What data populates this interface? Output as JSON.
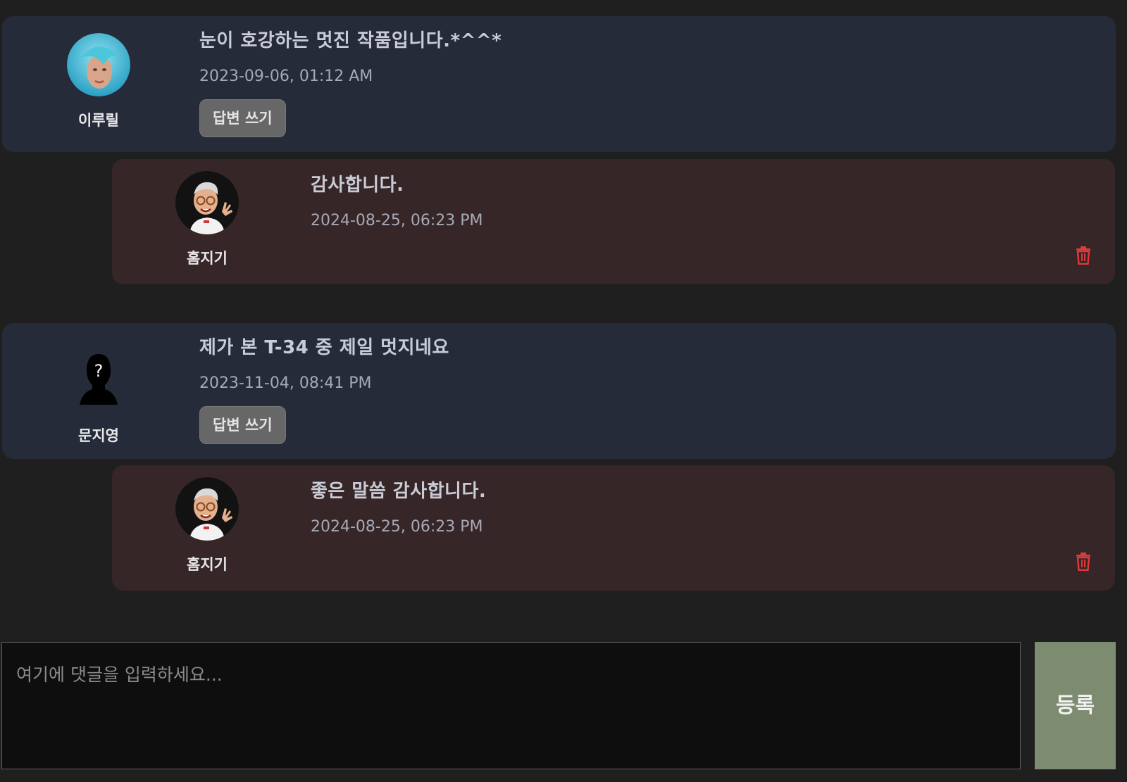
{
  "comments": [
    {
      "author": "이루릴",
      "avatar_icon": "blue-hair-avatar-icon",
      "text": "눈이 호강하는 멋진 작품입니다.*^^*",
      "date": "2023-09-06, 01:12 AM",
      "reply_button_label": "답변 쓰기",
      "reply": {
        "author": "홈지기",
        "avatar_icon": "memoji-avatar-icon",
        "text": "감사합니다.",
        "date": "2024-08-25, 06:23 PM",
        "delete_icon": "trash-icon"
      }
    },
    {
      "author": "문지영",
      "avatar_icon": "unknown-user-silhouette-icon",
      "text": "제가 본 T-34 중 제일 멋지네요",
      "date": "2023-11-04, 08:41 PM",
      "reply_button_label": "답변 쓰기",
      "reply": {
        "author": "홈지기",
        "avatar_icon": "memoji-avatar-icon",
        "text": "좋은 말씀 감사합니다.",
        "date": "2024-08-25, 06:23 PM",
        "delete_icon": "trash-icon"
      }
    }
  ],
  "comment_form": {
    "placeholder": "여기에 댓글을 입력하세요...",
    "submit_label": "등록"
  },
  "colors": {
    "comment_bg": "#262b3a",
    "reply_bg": "#372627",
    "submit_bg": "#7d8b71",
    "delete": "#e03a3a"
  }
}
